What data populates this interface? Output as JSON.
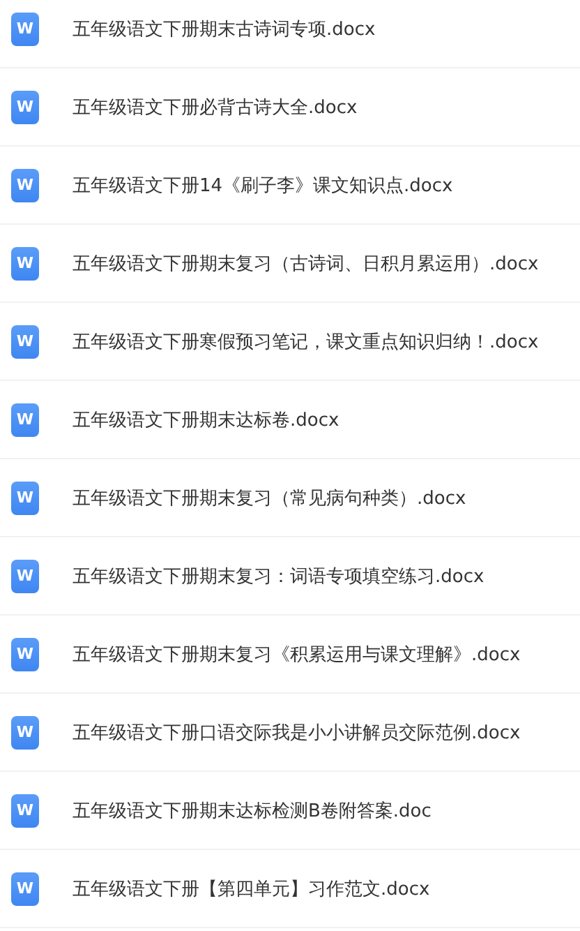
{
  "files": [
    {
      "icon_label": "W",
      "name": "五年级语文下册期末古诗词专项.docx"
    },
    {
      "icon_label": "W",
      "name": "五年级语文下册必背古诗大全.docx"
    },
    {
      "icon_label": "W",
      "name": "五年级语文下册14《刷子李》课文知识点.docx"
    },
    {
      "icon_label": "W",
      "name": "五年级语文下册期末复习（古诗词、日积月累运用）.docx"
    },
    {
      "icon_label": "W",
      "name": "五年级语文下册寒假预习笔记，课文重点知识归纳！.docx"
    },
    {
      "icon_label": "W",
      "name": "五年级语文下册期末达标卷.docx"
    },
    {
      "icon_label": "W",
      "name": "五年级语文下册期末复习（常见病句种类）.docx"
    },
    {
      "icon_label": "W",
      "name": "五年级语文下册期末复习：词语专项填空练习.docx"
    },
    {
      "icon_label": "W",
      "name": "五年级语文下册期末复习《积累运用与课文理解》.docx"
    },
    {
      "icon_label": "W",
      "name": "五年级语文下册口语交际我是小小讲解员交际范例.docx"
    },
    {
      "icon_label": "W",
      "name": "五年级语文下册期末达标检测B卷附答案.doc"
    },
    {
      "icon_label": "W",
      "name": "五年级语文下册【第四单元】习作范文.docx"
    }
  ]
}
